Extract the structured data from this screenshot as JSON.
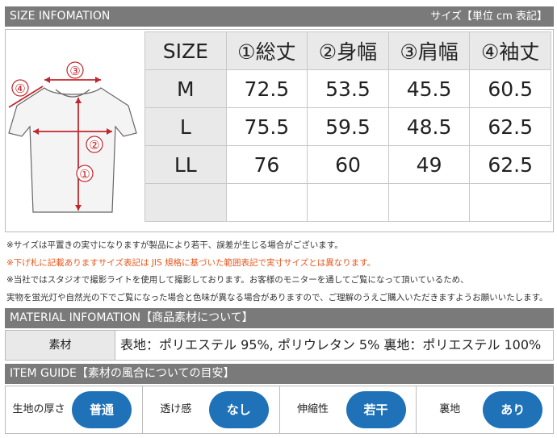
{
  "size_header": {
    "title": "SIZE INFOMATION",
    "unit": "サイズ【単位 cm 表記】"
  },
  "diagram": {
    "markers": [
      "①",
      "②",
      "③",
      "④"
    ]
  },
  "size_table": {
    "columns": [
      "SIZE",
      "①総丈",
      "②身幅",
      "③肩幅",
      "④袖丈"
    ],
    "rows": [
      [
        "M",
        "72.5",
        "53.5",
        "45.5",
        "60.5"
      ],
      [
        "L",
        "75.5",
        "59.5",
        "48.5",
        "62.5"
      ],
      [
        "LL",
        "76",
        "60",
        "49",
        "62.5"
      ],
      [
        "",
        "",
        "",
        "",
        ""
      ]
    ]
  },
  "notes": [
    "※サイズは平置きの実寸になりますが製品により若干、誤差が生じる場合がございます。",
    "※下げ札に記載ありますサイズ表記は JIS 規格に基づいた範囲表記で実寸サイズとは異なります。",
    "※当社ではスタジオで撮影ライトを使用して撮影しております。お客様のモニターを通してご覧になって頂いているため、",
    "実物を蛍光灯や自然光の下でご覧になった場合と色味が異なる場合がありますので、ご理解のうえご購入いただきますようお願いいたします。"
  ],
  "material_header": {
    "title": "MATERIAL INFOMATION【商品素材について】"
  },
  "material": {
    "label": "素材",
    "value": "表地：ポリエステル 95%, ポリウレタン 5% 裏地：ポリエステル 100%"
  },
  "guide_header": {
    "title": "ITEM GUIDE【素材の風合についての目安】"
  },
  "guide": [
    {
      "label": "生地の厚さ",
      "value": "普通"
    },
    {
      "label": "透け感",
      "value": "なし"
    },
    {
      "label": "伸縮性",
      "value": "若干"
    },
    {
      "label": "裏地",
      "value": "あり"
    }
  ],
  "colors": {
    "bar": "#7a7a7a",
    "red_note": "#e8571d",
    "pill": "#1f72b8",
    "marker": "#c1272d"
  }
}
